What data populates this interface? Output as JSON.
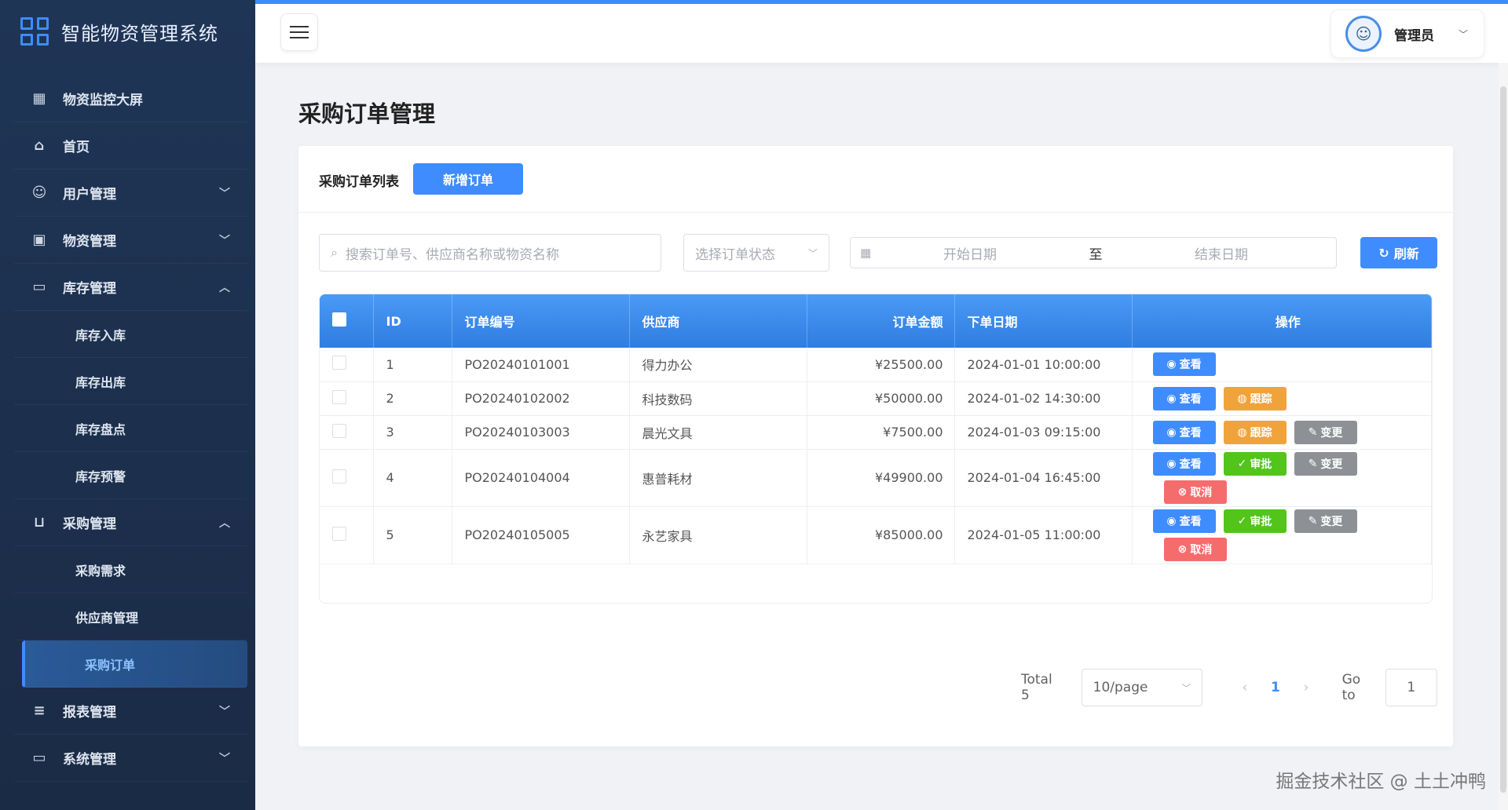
{
  "brand": {
    "title": "智能物资管理系统"
  },
  "menu": [
    {
      "label": "物资监控大屏",
      "icon": "grid-icon",
      "glyph": "▦"
    },
    {
      "label": "首页",
      "icon": "home-icon",
      "glyph": "⌂"
    },
    {
      "label": "用户管理",
      "icon": "users-icon",
      "glyph": "☺",
      "chevron": "﹀"
    },
    {
      "label": "物资管理",
      "icon": "box-icon",
      "glyph": "▣",
      "chevron": "﹀"
    },
    {
      "label": "库存管理",
      "icon": "book-icon",
      "glyph": "▭",
      "chevron": "︿"
    },
    {
      "label": "库存入库",
      "sub": true
    },
    {
      "label": "库存出库",
      "sub": true
    },
    {
      "label": "库存盘点",
      "sub": true
    },
    {
      "label": "库存预警",
      "sub": true
    },
    {
      "label": "采购管理",
      "icon": "cart-icon",
      "glyph": "⊔",
      "chevron": "︿"
    },
    {
      "label": "采购需求",
      "sub": true
    },
    {
      "label": "供应商管理",
      "sub": true
    },
    {
      "label": "采购订单",
      "sub": true,
      "active": true
    },
    {
      "label": "报表管理",
      "icon": "chart-icon",
      "glyph": "≡",
      "chevron": "﹀"
    },
    {
      "label": "系统管理",
      "icon": "monitor-icon",
      "glyph": "▭",
      "chevron": "﹀"
    }
  ],
  "header": {
    "user_name": "管理员"
  },
  "page": {
    "title": "采购订单管理"
  },
  "card": {
    "list_label": "采购订单列表",
    "new_button": "新增订单"
  },
  "filters": {
    "search_placeholder": "搜索订单号、供应商名称或物资名称",
    "status_placeholder": "选择订单状态",
    "start_date": "开始日期",
    "date_sep": "至",
    "end_date": "结束日期",
    "refresh": "刷新"
  },
  "table": {
    "headers": {
      "id": "ID",
      "order_no": "订单编号",
      "supplier": "供应商",
      "amount": "订单金额",
      "date": "下单日期",
      "ops": "操作"
    },
    "rows": [
      {
        "id": "1",
        "order_no": "PO20240101001",
        "supplier": "得力办公",
        "amount": "¥25500.00",
        "date": "2024-01-01 10:00:00",
        "actions": [
          "view"
        ]
      },
      {
        "id": "2",
        "order_no": "PO20240102002",
        "supplier": "科技数码",
        "amount": "¥50000.00",
        "date": "2024-01-02 14:30:00",
        "actions": [
          "view",
          "track"
        ]
      },
      {
        "id": "3",
        "order_no": "PO20240103003",
        "supplier": "晨光文具",
        "amount": "¥7500.00",
        "date": "2024-01-03 09:15:00",
        "actions": [
          "view",
          "track",
          "change"
        ]
      },
      {
        "id": "4",
        "order_no": "PO20240104004",
        "supplier": "惠普耗材",
        "amount": "¥49900.00",
        "date": "2024-01-04 16:45:00",
        "actions": [
          "view",
          "approve",
          "change",
          "cancel"
        ]
      },
      {
        "id": "5",
        "order_no": "PO20240105005",
        "supplier": "永艺家具",
        "amount": "¥85000.00",
        "date": "2024-01-05 11:00:00",
        "actions": [
          "view",
          "approve",
          "change",
          "cancel"
        ]
      }
    ],
    "action_labels": {
      "view": {
        "label": "查看",
        "glyph": "◉",
        "icon": "eye-icon"
      },
      "track": {
        "label": "跟踪",
        "glyph": "◍",
        "icon": "location-icon"
      },
      "change": {
        "label": "变更",
        "glyph": "✎",
        "icon": "edit-icon"
      },
      "approve": {
        "label": "审批",
        "glyph": "✓",
        "icon": "check-icon"
      },
      "cancel": {
        "label": "取消",
        "glyph": "⊗",
        "icon": "cancel-icon"
      }
    }
  },
  "pager": {
    "total": "Total 5",
    "page_size": "10/page",
    "current_page": "1",
    "goto_label": "Go to",
    "goto_value": "1"
  },
  "watermark": "掘金技术社区 @ 土土冲鸭",
  "colors": {
    "primary": "#3f8cff",
    "sidebar_bg": "#1f3556",
    "warning": "#f0a33b",
    "success": "#52c41a",
    "danger": "#f56c6c",
    "info": "#8d9095"
  }
}
